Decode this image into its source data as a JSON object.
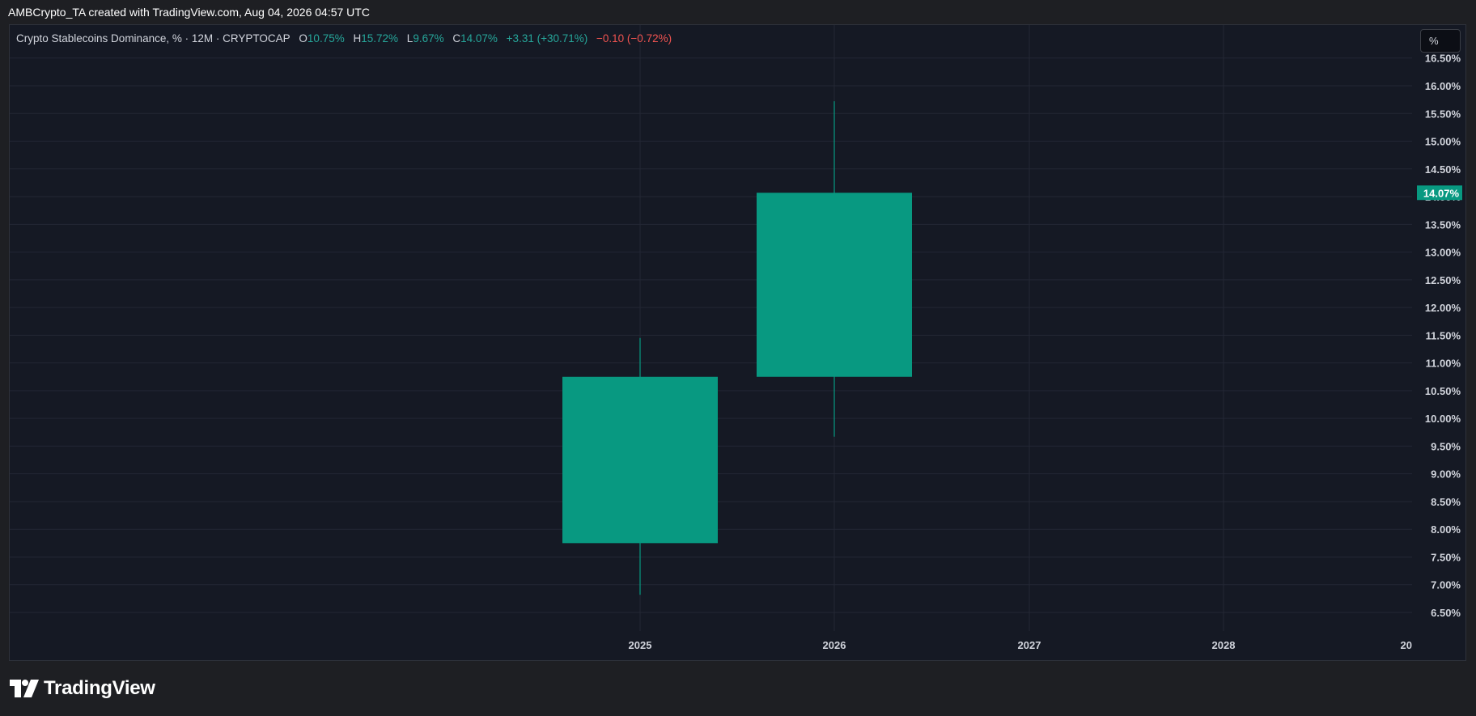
{
  "caption": "AMBCrypto_TA created with TradingView.com, Aug 04, 2026 04:57 UTC",
  "legend": {
    "symbol": "Crypto Stablecoins Dominance, % · 12M · CRYPTOCAP",
    "o_label": "O",
    "o_value": "10.75%",
    "h_label": "H",
    "h_value": "15.72%",
    "l_label": "L",
    "l_value": "9.67%",
    "c_label": "C",
    "c_value": "14.07%",
    "change": "+3.31 (+30.71%)",
    "change2": "−0.10 (−0.72%)"
  },
  "scale_button": "%",
  "brand": "TradingView",
  "colors": {
    "up": "#089981",
    "grid": "#232734",
    "axis_text": "#d1d4dc",
    "background": "#151924"
  },
  "chart_data": {
    "type": "candlestick",
    "price_axis_labels": [
      "16.50%",
      "16.00%",
      "15.50%",
      "15.00%",
      "14.50%",
      "14.00%",
      "13.50%",
      "13.00%",
      "12.50%",
      "12.00%",
      "11.50%",
      "11.00%",
      "10.50%",
      "10.00%",
      "9.50%",
      "9.00%",
      "8.50%",
      "8.00%",
      "7.50%",
      "7.00%",
      "6.50%"
    ],
    "price_axis_values": [
      16.5,
      16.0,
      15.5,
      15.0,
      14.5,
      14.0,
      13.5,
      13.0,
      12.5,
      12.0,
      11.5,
      11.0,
      10.5,
      10.0,
      9.5,
      9.0,
      8.5,
      8.0,
      7.5,
      7.0,
      6.5
    ],
    "time_axis_labels": [
      "2025",
      "2026",
      "2027",
      "2028",
      "20"
    ],
    "last_price_label": "14.07%",
    "last_price": 14.07,
    "candles": [
      {
        "period": "2025",
        "open": 7.75,
        "high": 11.45,
        "low": 6.82,
        "close": 10.75
      },
      {
        "period": "2026",
        "open": 10.75,
        "high": 15.72,
        "low": 9.67,
        "close": 14.07
      }
    ]
  }
}
